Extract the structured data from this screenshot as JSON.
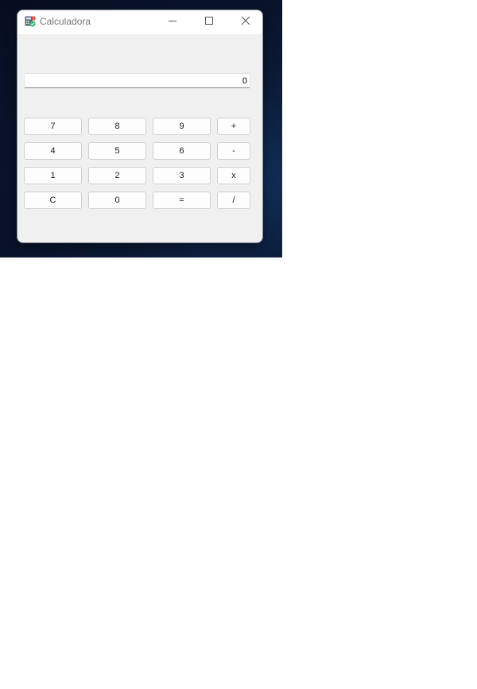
{
  "window": {
    "title": "Calculadora",
    "icon": "calculator-app-icon",
    "controls": [
      "minimize-icon",
      "maximize-icon",
      "close-icon"
    ]
  },
  "display": {
    "value": "0"
  },
  "keypad": {
    "rows": [
      [
        "7",
        "8",
        "9",
        "+"
      ],
      [
        "4",
        "5",
        "6",
        "-"
      ],
      [
        "1",
        "2",
        "3",
        "x"
      ],
      [
        "C",
        "0",
        "=",
        "/"
      ]
    ]
  },
  "colors": {
    "window_bg": "#f0f0f0",
    "titlebar_bg": "#ffffff",
    "key_bg": "#fdfdfd",
    "key_border": "#cfcfcf",
    "desktop": "#0b1a36"
  }
}
